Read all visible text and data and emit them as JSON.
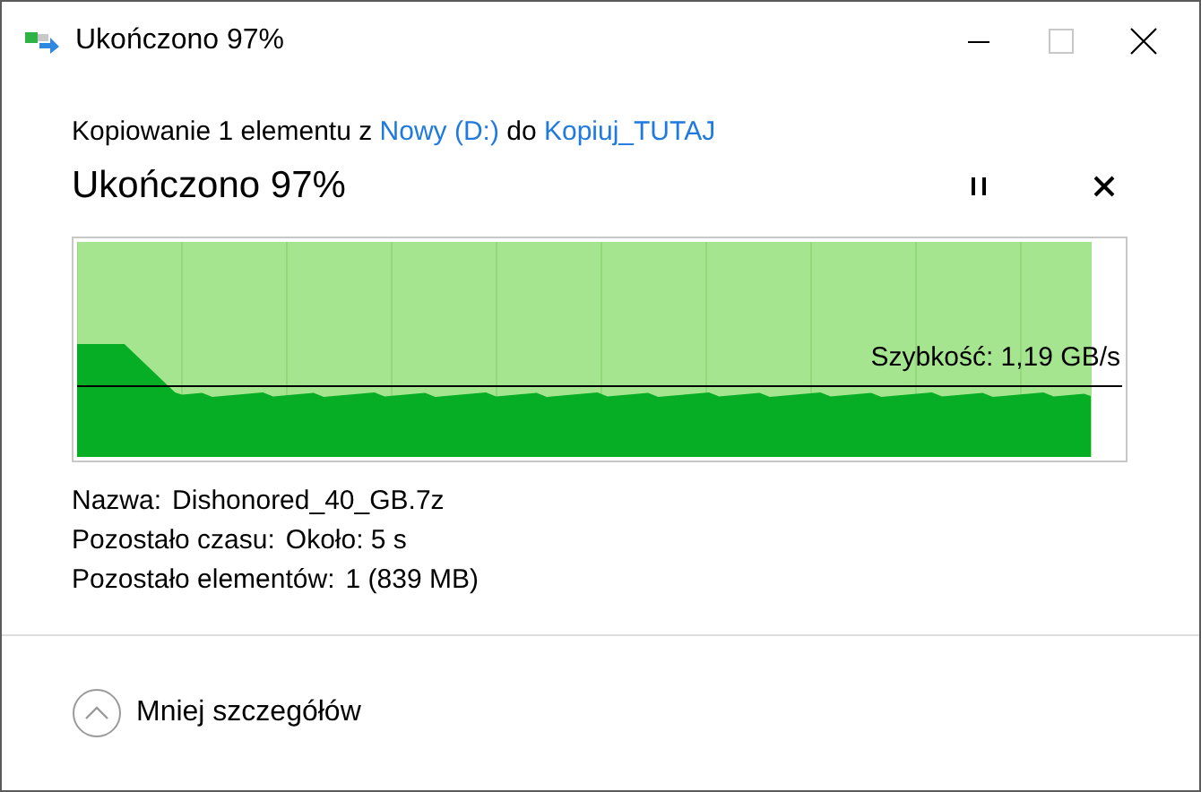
{
  "window": {
    "title": "Ukończono 97%"
  },
  "operation": {
    "prefix": "Kopiowanie 1 elementu z",
    "source": "Nowy (D:)",
    "middle": "do",
    "destination": "Kopiuj_TUTAJ"
  },
  "heading": "Ukończono 97%",
  "progress": {
    "level": 0.97,
    "speed": "Szybkość: 1,19 GB/s"
  },
  "details": [
    {
      "label": "Nazwa:",
      "value": "Dishonored_40_GB.7z"
    },
    {
      "label": "Pozostało czasu:",
      "value": "Około: 5 s"
    },
    {
      "label": "Pozostało elementów:",
      "value": "1 (839 MB)"
    }
  ],
  "footer": {
    "toggle": "Mniej szczegółów",
    "expanded": true
  }
}
